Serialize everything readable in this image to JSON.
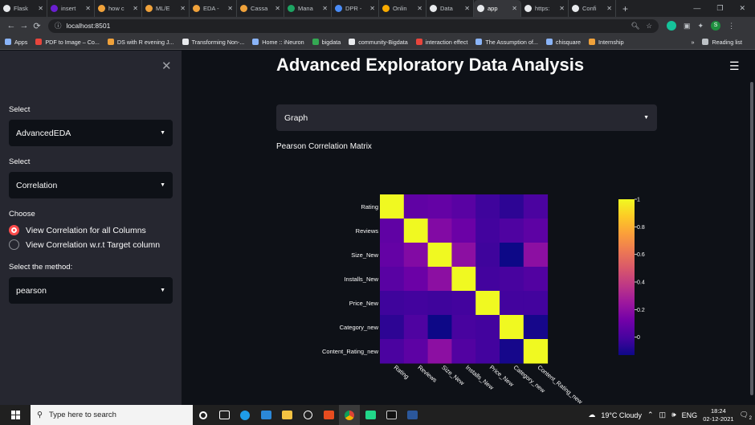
{
  "browser": {
    "tabs": [
      {
        "label": "Flask",
        "color": "#e8eaed"
      },
      {
        "label": "insert",
        "color": "#6a1fd1"
      },
      {
        "label": "how c",
        "color": "#f0a23b"
      },
      {
        "label": "ML/E",
        "color": "#f0a23b"
      },
      {
        "label": "EDA -",
        "color": "#f0a23b"
      },
      {
        "label": "Cassa",
        "color": "#f0a23b"
      },
      {
        "label": "Mana",
        "color": "#1da462"
      },
      {
        "label": "DPR -",
        "color": "#4a8cf7"
      },
      {
        "label": "Onlin",
        "color": "#f9ab00"
      },
      {
        "label": "Data",
        "color": "#e8eaed"
      },
      {
        "label": "app",
        "color": "#e8eaed"
      },
      {
        "label": "https:",
        "color": "#e8eaed"
      },
      {
        "label": "Confi",
        "color": "#e8eaed"
      }
    ],
    "url": "localhost:8501",
    "profile_initial": "S",
    "bookmarks": [
      {
        "label": "Apps",
        "color": "#8ab4f8"
      },
      {
        "label": "PDF to Image – Co...",
        "color": "#e8453c"
      },
      {
        "label": "DS with R evening J...",
        "color": "#f0a23b"
      },
      {
        "label": "Transforming Non-...",
        "color": "#e8eaed"
      },
      {
        "label": "Home :: iNeuron",
        "color": "#8ab4f8"
      },
      {
        "label": "bigdata",
        "color": "#34a853"
      },
      {
        "label": "community-Bigdata",
        "color": "#e8eaed"
      },
      {
        "label": "interaction effect",
        "color": "#e8453c"
      },
      {
        "label": "The Assumption of...",
        "color": "#8ab4f8"
      },
      {
        "label": "chisquare",
        "color": "#8ab4f8"
      },
      {
        "label": "Internship",
        "color": "#f0a23b"
      }
    ],
    "reading_list": "Reading list"
  },
  "sidebar": {
    "select1_label": "Select",
    "select1_value": "AdvancedEDA",
    "select2_label": "Select",
    "select2_value": "Correlation",
    "choose_label": "Choose",
    "radio_options": [
      "View Correlation for all Columns",
      "View Correlation w.r.t Target column"
    ],
    "method_label": "Select the method:",
    "method_value": "pearson"
  },
  "main": {
    "title": "Advanced Exploratory Data Analysis",
    "graph_select_value": "Graph",
    "plot_title": "Pearson Correlation Matrix"
  },
  "chart_data": {
    "type": "heatmap",
    "title": "Pearson Correlation Matrix",
    "labels": [
      "Rating",
      "Reviews",
      "Size_New",
      "Installs_New",
      "Price_New",
      "Category_new",
      "Content_Rating_new"
    ],
    "matrix": [
      [
        1.0,
        0.07,
        0.08,
        0.05,
        -0.02,
        -0.06,
        0.01
      ],
      [
        0.07,
        1.0,
        0.17,
        0.1,
        -0.01,
        0.02,
        0.06
      ],
      [
        0.08,
        0.17,
        1.0,
        0.2,
        -0.02,
        -0.13,
        0.2
      ],
      [
        0.05,
        0.1,
        0.2,
        1.0,
        -0.01,
        0.0,
        0.03
      ],
      [
        -0.02,
        -0.01,
        -0.02,
        -0.01,
        1.0,
        -0.01,
        -0.01
      ],
      [
        -0.06,
        0.02,
        -0.13,
        0.0,
        -0.01,
        1.0,
        -0.11
      ],
      [
        0.01,
        0.06,
        0.2,
        0.03,
        -0.01,
        -0.11,
        1.0
      ]
    ],
    "colorbar_ticks": [
      0,
      0.2,
      0.4,
      0.6,
      0.8,
      1
    ],
    "colorbar_range": [
      -0.13,
      1
    ],
    "colormap": "plasma"
  },
  "taskbar": {
    "search_placeholder": "Type here to search",
    "weather": "19°C  Cloudy",
    "language": "ENG",
    "time": "18:24",
    "date": "02-12-2021",
    "notification_count": "2"
  }
}
